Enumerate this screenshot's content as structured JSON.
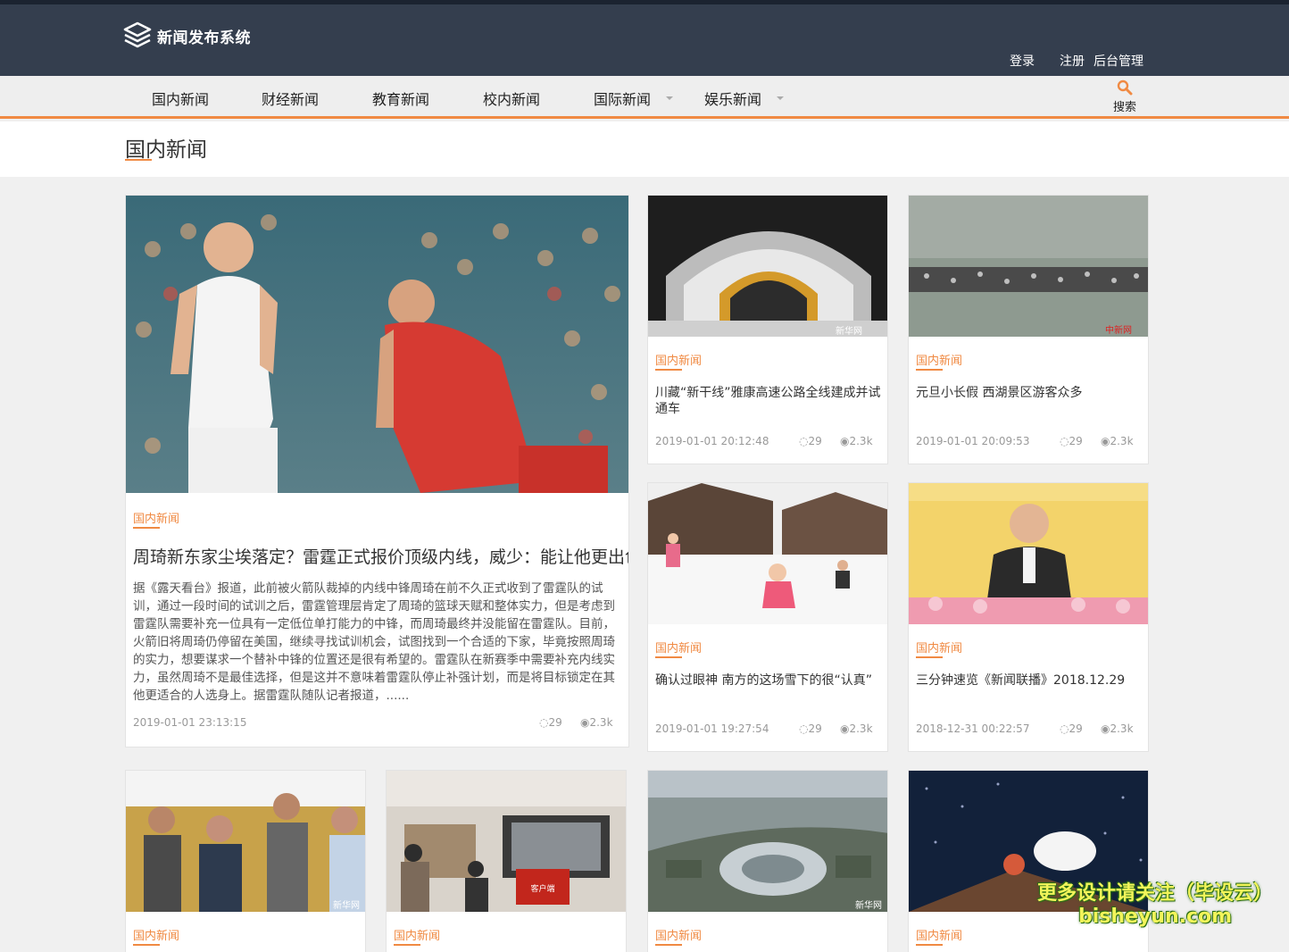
{
  "brand": {
    "title": "新闻发布系统"
  },
  "header_links": {
    "login": "登录",
    "register": "注册",
    "admin": "后台管理"
  },
  "nav": {
    "items": [
      "国内新闻",
      "财经新闻",
      "教育新闻",
      "校内新闻",
      "国际新闻",
      "娱乐新闻"
    ],
    "search_label": "搜索"
  },
  "page": {
    "title": "国内新闻"
  },
  "featured": {
    "category": "国内新闻",
    "title": "周琦新东家尘埃落定？雷霆正式报价顶级内线，威少：能让他更出色",
    "summary": "据《露天看台》报道，此前被火箭队裁掉的内线中锋周琦在前不久正式收到了雷霆队的试训，通过一段时间的试训之后，雷霆管理层肯定了周琦的篮球天赋和整体实力，但是考虑到雷霆队需要补充一位具有一定低位单打能力的中锋，而周琦最终并没能留在雷霆队。目前，火箭旧将周琦仍停留在美国，继续寻找试训机会，试图找到一个合适的下家，毕竟按照周琦的实力，想要谋求一个替补中锋的位置还是很有希望的。雷霆队在新赛季中需要补充内线实力，虽然周琦不是最佳选择，但是这并不意味着雷霆队停止补强计划，而是将目标锁定在其他更适合的人选身上。据雷霆队随队记者报道，......",
    "date": "2019-01-01 23:13:15",
    "comments": "29",
    "views": "2.3k"
  },
  "cards": [
    {
      "category": "国内新闻",
      "title": "川藏“新干线”雅康高速公路全线建成并试通车",
      "date": "2019-01-01 20:12:48",
      "comments": "29",
      "views": "2.3k"
    },
    {
      "category": "国内新闻",
      "title": "元旦小长假 西湖景区游客众多",
      "date": "2019-01-01 20:09:53",
      "comments": "29",
      "views": "2.3k"
    },
    {
      "category": "国内新闻",
      "title": "确认过眼神 南方的这场雪下的很“认真”",
      "date": "2019-01-01 19:27:54",
      "comments": "29",
      "views": "2.3k"
    },
    {
      "category": "国内新闻",
      "title": "三分钟速览《新闻联播》2018.12.29",
      "date": "2018-12-31 00:22:57",
      "comments": "29",
      "views": "2.3k"
    }
  ],
  "bottom_cards": [
    {
      "category": "国内新闻"
    },
    {
      "category": "国内新闻"
    },
    {
      "category": "国内新闻"
    },
    {
      "category": "国内新闻"
    }
  ],
  "image_marks": {
    "xinhua": "新华网",
    "chinanews": "中新网",
    "app": "客户端"
  },
  "watermark": {
    "line1": "更多设计请关注（毕设云）",
    "line2": "bisheyun.com"
  }
}
